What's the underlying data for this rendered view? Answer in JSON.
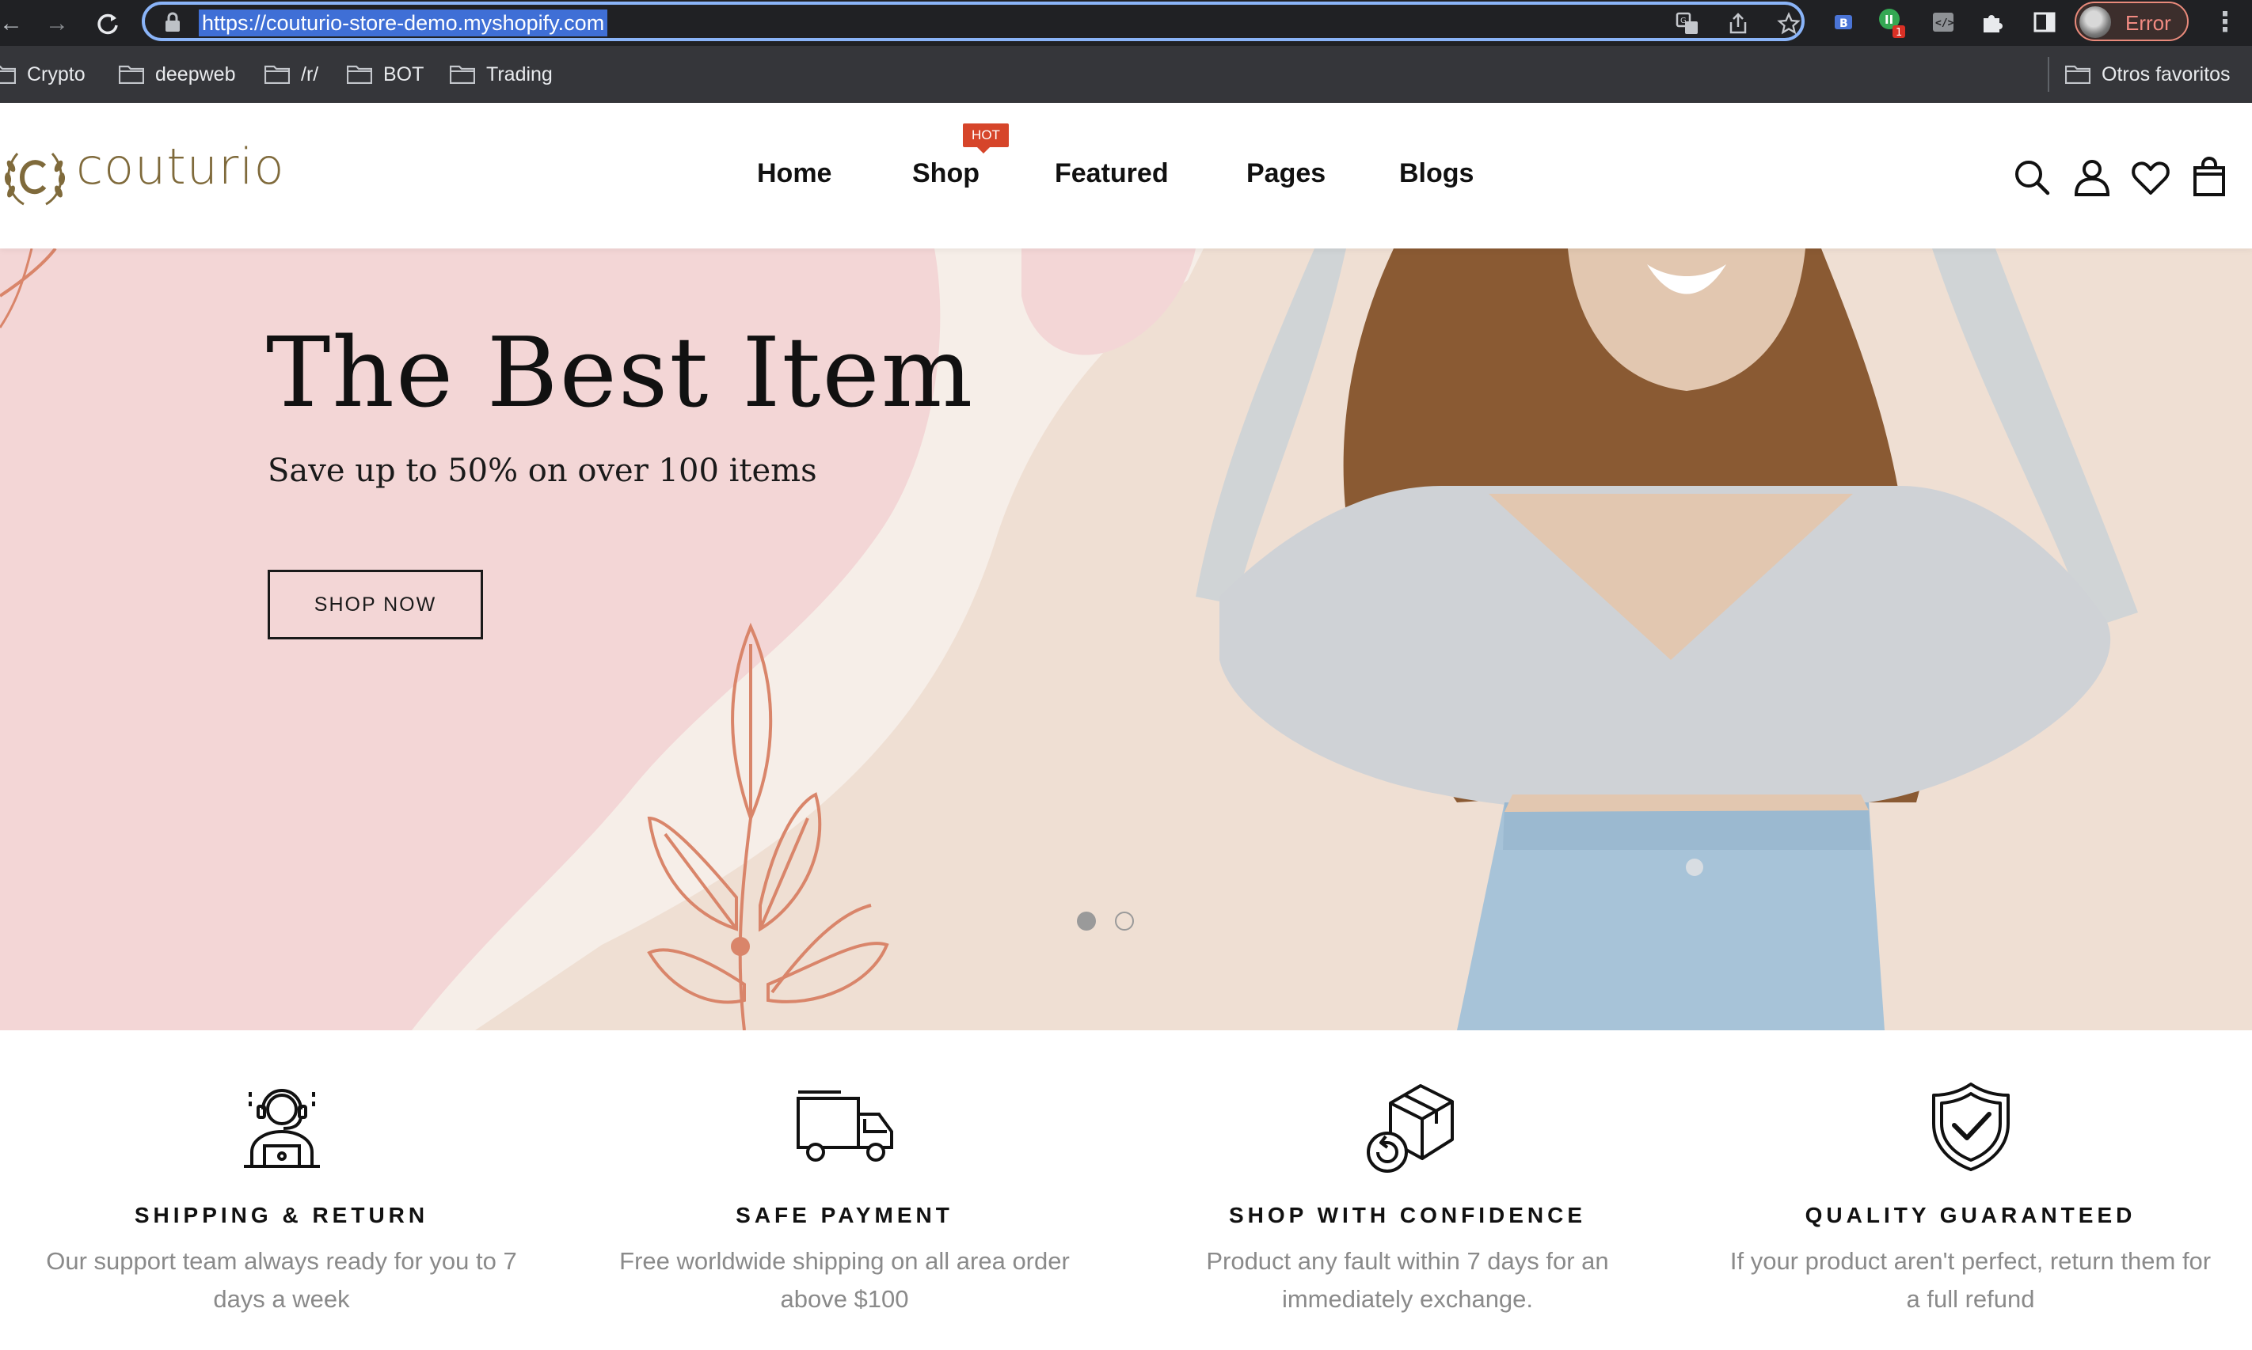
{
  "browser": {
    "url": "https://couturio-store-demo.myshopify.com",
    "profile_label": "Error",
    "extension_badge_count": "1",
    "bookmarks": [
      "Crypto",
      "deepweb",
      "/r/",
      "BOT",
      "Trading"
    ],
    "other_bookmarks": "Otros favoritos"
  },
  "site": {
    "logo_text": "couturio",
    "menu": [
      "Home",
      "Shop",
      "Featured",
      "Pages",
      "Blogs"
    ],
    "hot_badge": "HOT"
  },
  "hero": {
    "title": "The Best Item",
    "subtitle": "Save up to 50% on over 100 items",
    "cta": "SHOP NOW",
    "slides_total": 2,
    "active_slide": 1
  },
  "features": [
    {
      "icon": "support-agent-icon",
      "title": "SHIPPING & RETURN",
      "desc": "Our support team always ready for you to 7 days a week"
    },
    {
      "icon": "delivery-truck-icon",
      "title": "SAFE PAYMENT",
      "desc": "Free worldwide shipping on all area order above $100"
    },
    {
      "icon": "box-return-icon",
      "title": "SHOP WITH CONFIDENCE",
      "desc": "Product any fault within 7 days for an immediately exchange."
    },
    {
      "icon": "shield-check-icon",
      "title": "QUALITY GUARANTEED",
      "desc": "If your product aren't perfect, return them for a full refund"
    }
  ],
  "colors": {
    "accent_hot": "#d6452a",
    "logo": "#7f6a3b",
    "hero_pink": "#f2d5d5",
    "leaf": "#d9856a"
  }
}
